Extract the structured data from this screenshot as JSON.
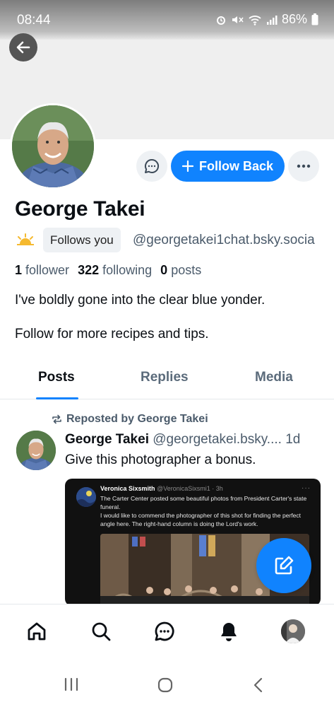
{
  "status_bar": {
    "time": "08:44",
    "battery": "86%"
  },
  "profile": {
    "display_name": "George Takei",
    "follows_you_label": "Follows you",
    "handle": "@georgetakei1chat.bsky.socia",
    "stats": {
      "followers_count": "1",
      "followers_label": "follower",
      "following_count": "322",
      "following_label": "following",
      "posts_count": "0",
      "posts_label": "posts"
    },
    "bio_line1": "I've boldly gone into the clear blue yonder.",
    "bio_line2": "Follow for more recipes and tips."
  },
  "actions": {
    "follow_back_label": "Follow Back"
  },
  "tabs": [
    {
      "label": "Posts",
      "active": true
    },
    {
      "label": "Replies",
      "active": false
    },
    {
      "label": "Media",
      "active": false
    }
  ],
  "post": {
    "repost_label": "Reposted by George Takei",
    "author_name": "George Takei",
    "author_handle": "@georgetakei.bsky....",
    "time": "1d",
    "text": "Give this photographer a bonus.",
    "embed": {
      "author": "Veronica Sixsmith",
      "author_meta": "@VeronicaSixsmi1 · 3h",
      "line1": "The Carter Center posted some beautiful photos from President Carter's state funeral.",
      "line2": "I would like to commend the photographer of this shot for finding the perfect angle here. The right-hand column is doing the Lord's work."
    }
  },
  "icons": {
    "back": "arrow-left-icon",
    "chat": "chat-bubble-icon",
    "plus": "plus-icon",
    "more": "ellipsis-icon",
    "weather": "sun-icon",
    "repost": "repost-icon",
    "compose": "compose-icon",
    "home": "home-icon",
    "search": "search-icon",
    "messages": "chat-icon",
    "notifications": "bell-icon"
  },
  "colors": {
    "accent": "#1083fe",
    "muted_text": "#4b5b6b",
    "chip_bg": "#eef1f4"
  }
}
